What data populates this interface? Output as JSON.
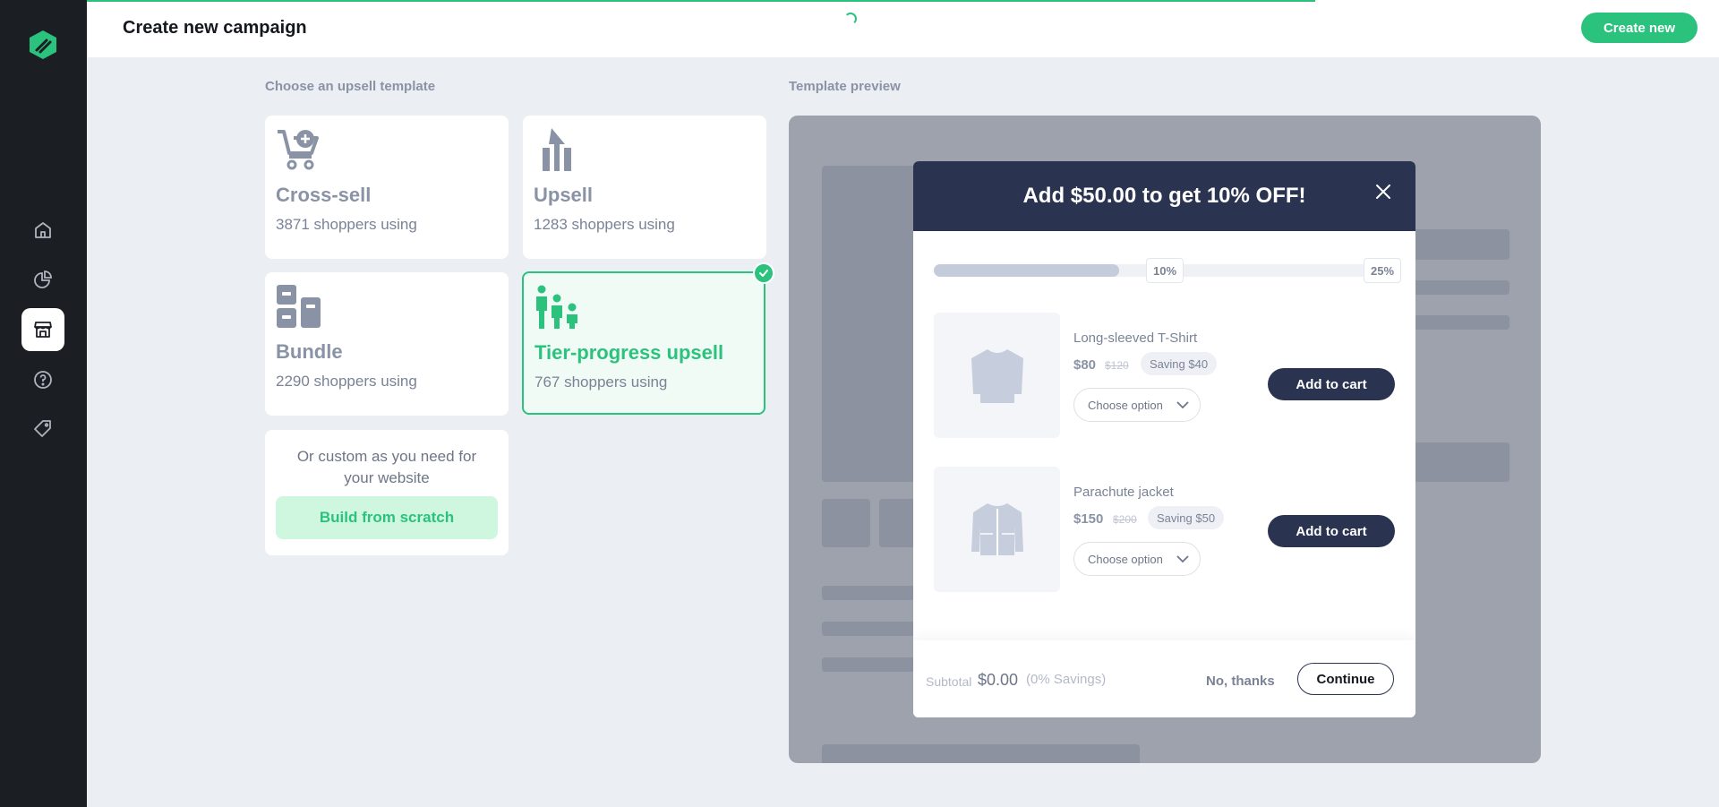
{
  "header": {
    "title": "Create new campaign",
    "create_label": "Create new"
  },
  "sidebar": {
    "items": [
      {
        "icon": "home-icon"
      },
      {
        "icon": "analytics-icon"
      },
      {
        "icon": "store-icon",
        "active": true
      },
      {
        "icon": "help-icon"
      },
      {
        "icon": "tag-icon"
      }
    ]
  },
  "templates": {
    "section_label": "Choose an upsell template",
    "cards": [
      {
        "title": "Cross-sell",
        "subtitle": "3871 shoppers using",
        "icon": "cart-plus-icon"
      },
      {
        "title": "Upsell",
        "subtitle": "1283 shoppers using",
        "icon": "arrow-up-icon"
      },
      {
        "title": "Bundle",
        "subtitle": "2290 shoppers using",
        "icon": "bundle-icon"
      },
      {
        "title": "Tier-progress upsell",
        "subtitle": "767 shoppers using",
        "icon": "tier-people-icon",
        "selected": true
      }
    ],
    "custom": {
      "text": "Or custom as you need for your website",
      "button": "Build from scratch"
    }
  },
  "preview": {
    "section_label": "Template preview",
    "modal": {
      "title": "Add $50.00 to get 10% OFF!",
      "progress": {
        "fill_fraction": 0.4,
        "tier1": "10%",
        "tier2": "25%"
      },
      "products": [
        {
          "name": "Long-sleeved T-Shirt",
          "price": "$80",
          "old_price": "$120",
          "saving": "Saving $40",
          "option": "Choose option",
          "cta": "Add to cart"
        },
        {
          "name": "Parachute jacket",
          "price": "$150",
          "old_price": "$200",
          "saving": "Saving $50",
          "option": "Choose option",
          "cta": "Add to cart"
        }
      ],
      "footer": {
        "subtotal_label": "Subtotal",
        "subtotal_value": "$0.00",
        "savings": "(0% Savings)",
        "decline": "No, thanks",
        "continue": "Continue"
      }
    }
  },
  "colors": {
    "accent": "#2BC27E",
    "sidebar": "#1B1F24",
    "navy": "#2A3450",
    "background": "#EBEEF3"
  }
}
